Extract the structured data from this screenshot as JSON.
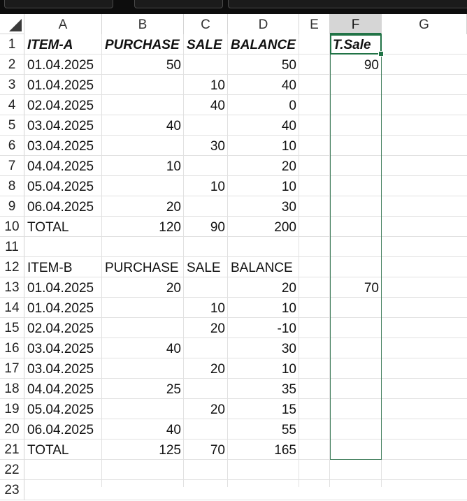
{
  "columns": [
    "A",
    "B",
    "C",
    "D",
    "E",
    "F",
    "G"
  ],
  "selected_column": "F",
  "rows": [
    {
      "n": "1",
      "a": "ITEM-A",
      "b": "PURCHASE",
      "c": "SALE",
      "d": "BALANCE",
      "f": "T.Sale",
      "header": true
    },
    {
      "n": "2",
      "a": "01.04.2025",
      "b": "50",
      "c": "",
      "d": "50",
      "f": "90"
    },
    {
      "n": "3",
      "a": "01.04.2025",
      "b": "",
      "c": "10",
      "d": "40",
      "f": ""
    },
    {
      "n": "4",
      "a": "02.04.2025",
      "b": "",
      "c": "40",
      "d": "0",
      "f": ""
    },
    {
      "n": "5",
      "a": "03.04.2025",
      "b": "40",
      "c": "",
      "d": "40",
      "f": ""
    },
    {
      "n": "6",
      "a": "03.04.2025",
      "b": "",
      "c": "30",
      "d": "10",
      "f": ""
    },
    {
      "n": "7",
      "a": "04.04.2025",
      "b": "10",
      "c": "",
      "d": "20",
      "f": ""
    },
    {
      "n": "8",
      "a": "05.04.2025",
      "b": "",
      "c": "10",
      "d": "10",
      "f": ""
    },
    {
      "n": "9",
      "a": "06.04.2025",
      "b": "20",
      "c": "",
      "d": "30",
      "f": ""
    },
    {
      "n": "10",
      "a": "TOTAL",
      "b": "120",
      "c": "90",
      "d": "200",
      "f": ""
    },
    {
      "n": "11",
      "a": "",
      "b": "",
      "c": "",
      "d": "",
      "f": ""
    },
    {
      "n": "12",
      "a": "ITEM-B",
      "b": "PURCHASE",
      "c": "SALE",
      "d": "BALANCE",
      "f": "",
      "subheader": true
    },
    {
      "n": "13",
      "a": "01.04.2025",
      "b": "20",
      "c": "",
      "d": "20",
      "f": "70"
    },
    {
      "n": "14",
      "a": "01.04.2025",
      "b": "",
      "c": "10",
      "d": "10",
      "f": ""
    },
    {
      "n": "15",
      "a": "02.04.2025",
      "b": "",
      "c": "20",
      "d": "-10",
      "f": ""
    },
    {
      "n": "16",
      "a": "03.04.2025",
      "b": "40",
      "c": "",
      "d": "30",
      "f": ""
    },
    {
      "n": "17",
      "a": "03.04.2025",
      "b": "",
      "c": "20",
      "d": "10",
      "f": ""
    },
    {
      "n": "18",
      "a": "04.04.2025",
      "b": "25",
      "c": "",
      "d": "35",
      "f": ""
    },
    {
      "n": "19",
      "a": "05.04.2025",
      "b": "",
      "c": "20",
      "d": "15",
      "f": ""
    },
    {
      "n": "20",
      "a": "06.04.2025",
      "b": "40",
      "c": "",
      "d": "55",
      "f": ""
    },
    {
      "n": "21",
      "a": "TOTAL",
      "b": "125",
      "c": "70",
      "d": "165",
      "f": ""
    },
    {
      "n": "22",
      "a": "",
      "b": "",
      "c": "",
      "d": "",
      "f": ""
    },
    {
      "n": "23",
      "a": "",
      "b": "",
      "c": "",
      "d": "",
      "f": ""
    }
  ],
  "colors": {
    "selection": "#217346",
    "header_fill": "#d6d6d6",
    "gridline": "#e1e1e1"
  }
}
